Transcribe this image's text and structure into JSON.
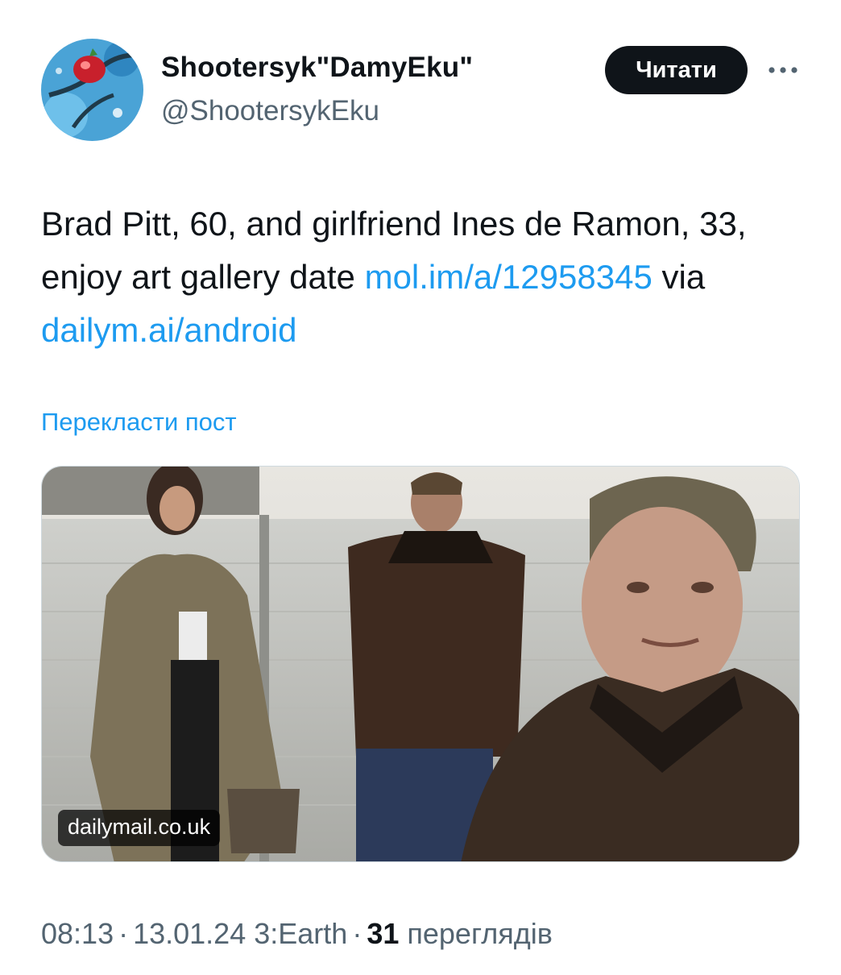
{
  "author": {
    "display_name": "Shootersyk\"DamyEku\"",
    "handle": "@ShootersykEku"
  },
  "follow_button": {
    "label": "Читати"
  },
  "more_icon": "more-horizontal-icon",
  "tweet": {
    "text_before_link1": "Brad Pitt, 60, and girlfriend Ines de Ramon, 33, enjoy art gallery date ",
    "link1": "mol.im/a/12958345",
    "text_between": " via ",
    "link2": "dailym.ai/android"
  },
  "translate_link": "Перекласти пост",
  "media": {
    "source_label": "dailymail.co.uk"
  },
  "meta": {
    "time": "08:13",
    "date": "13.01.24",
    "client": "3:Earth",
    "views_count": "31",
    "views_label": "переглядів"
  },
  "colors": {
    "link": "#1d9bf0",
    "text": "#0f1419",
    "secondary": "#536471",
    "button_bg": "#0f1419"
  }
}
